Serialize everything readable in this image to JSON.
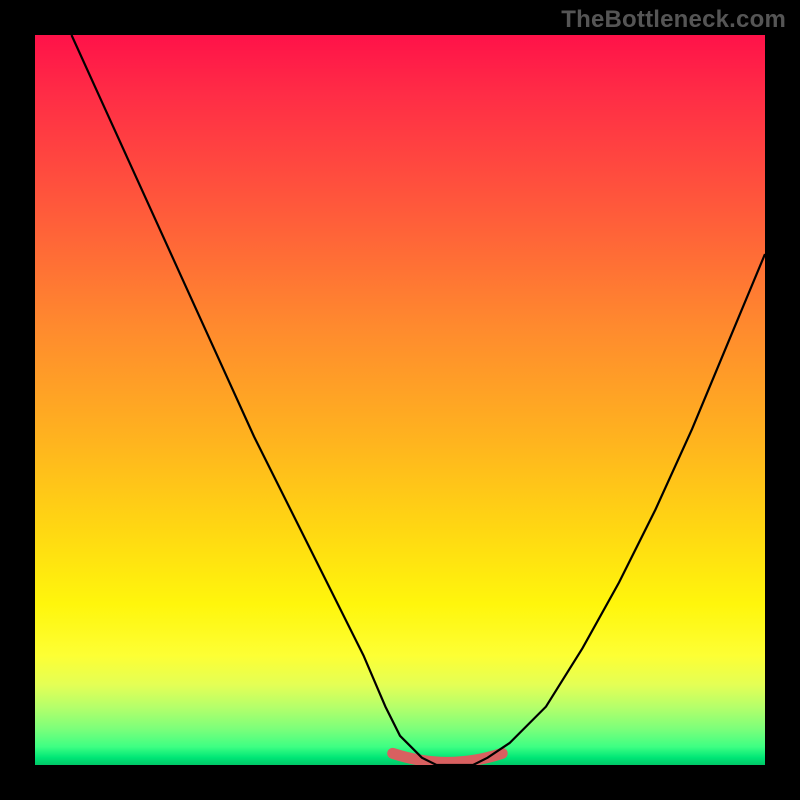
{
  "watermark": "TheBottleneck.com",
  "colors": {
    "frame": "#000000",
    "curve": "#000000",
    "highlight": "#d86060",
    "gradient_top": "#ff1249",
    "gradient_bottom": "#00c767"
  },
  "chart_data": {
    "type": "line",
    "title": "",
    "xlabel": "",
    "ylabel": "",
    "xlim": [
      0,
      100
    ],
    "ylim": [
      0,
      100
    ],
    "grid": false,
    "legend": false,
    "series": [
      {
        "name": "bottleneck-curve",
        "x": [
          5,
          10,
          15,
          20,
          25,
          30,
          35,
          40,
          45,
          48,
          50,
          53,
          55,
          58,
          60,
          62,
          65,
          70,
          75,
          80,
          85,
          90,
          95,
          100
        ],
        "y": [
          100,
          89,
          78,
          67,
          56,
          45,
          35,
          25,
          15,
          8,
          4,
          1,
          0,
          0,
          0,
          1,
          3,
          8,
          16,
          25,
          35,
          46,
          58,
          70
        ]
      }
    ],
    "annotations": [
      {
        "name": "valley-highlight",
        "x_range": [
          49,
          64
        ],
        "y": 0.5,
        "color": "#d86060"
      }
    ],
    "background_gradient": {
      "direction": "vertical",
      "stops": [
        {
          "pos": 0.0,
          "color": "#ff1249"
        },
        {
          "pos": 0.25,
          "color": "#ff5d3a"
        },
        {
          "pos": 0.55,
          "color": "#ffb21f"
        },
        {
          "pos": 0.78,
          "color": "#fff60c"
        },
        {
          "pos": 0.92,
          "color": "#b6ff6a"
        },
        {
          "pos": 1.0,
          "color": "#00c767"
        }
      ]
    }
  }
}
